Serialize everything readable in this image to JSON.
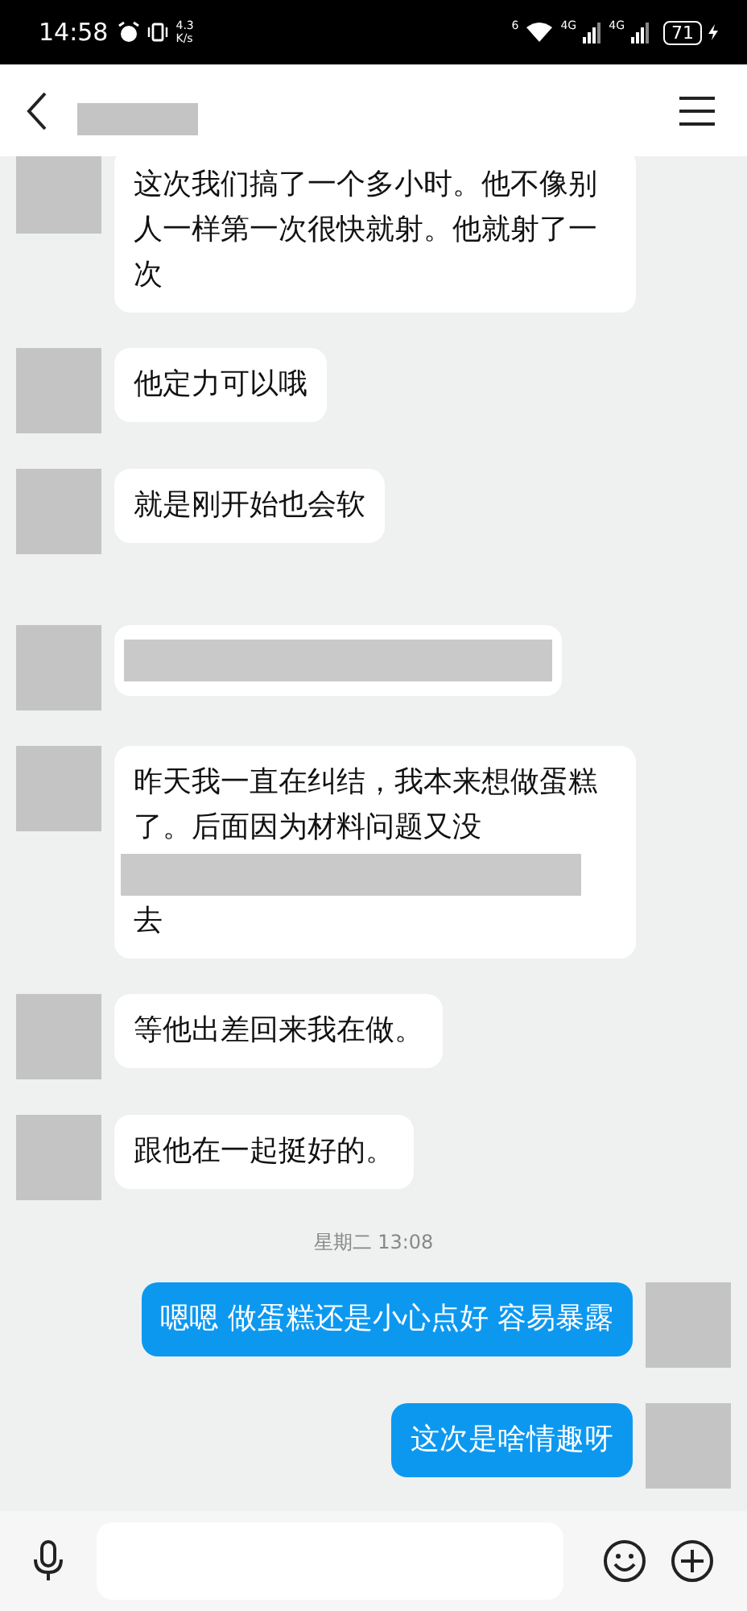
{
  "status_bar": {
    "time": "14:58",
    "speed_value": "4.3",
    "speed_unit": "K/s",
    "wifi_label": "6",
    "network_labels": [
      "4G",
      "4G"
    ],
    "battery": "71"
  },
  "messages": [
    {
      "kind": "incoming",
      "segments": [
        {
          "kind": "text",
          "text": "这次我们搞了一个多小时。他不像别人一样第一次很快就射。他就射了一次"
        }
      ]
    },
    {
      "kind": "incoming",
      "segments": [
        {
          "kind": "text",
          "text": "他定力可以哦"
        }
      ]
    },
    {
      "kind": "incoming",
      "segments": [
        {
          "kind": "text",
          "text": "就是刚开始也会软"
        }
      ]
    },
    {
      "kind": "redacted_time"
    },
    {
      "kind": "incoming",
      "segments": [
        {
          "kind": "redacted"
        }
      ]
    },
    {
      "kind": "incoming",
      "segments": [
        {
          "kind": "text",
          "text": "昨天我一直在纠结，我本来想做蛋糕了。后面因为材料问题又没"
        },
        {
          "kind": "redacted"
        },
        {
          "kind": "text",
          "text": "去"
        }
      ]
    },
    {
      "kind": "incoming",
      "segments": [
        {
          "kind": "text",
          "text": "等他出差回来我在做。"
        }
      ]
    },
    {
      "kind": "incoming",
      "segments": [
        {
          "kind": "text",
          "text": "跟他在一起挺好的。"
        }
      ]
    },
    {
      "kind": "time",
      "text": "星期二 13:08"
    },
    {
      "kind": "outgoing",
      "segments": [
        {
          "kind": "text",
          "text": "嗯嗯 做蛋糕还是小心点好 容易暴露"
        }
      ]
    },
    {
      "kind": "outgoing",
      "segments": [
        {
          "kind": "text",
          "text": "这次是啥情趣呀"
        }
      ]
    }
  ]
}
